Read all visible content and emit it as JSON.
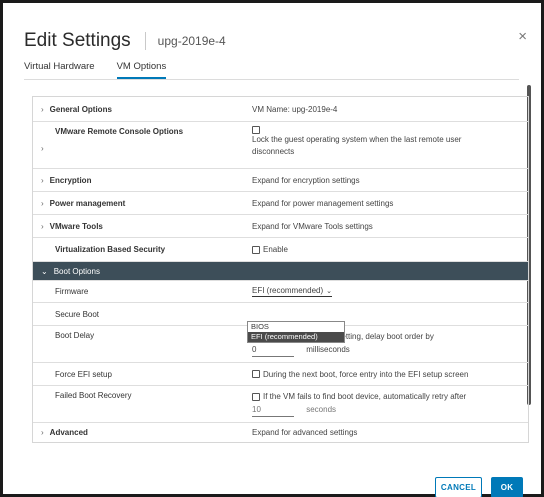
{
  "dialog": {
    "title": "Edit Settings",
    "vm_name": "upg-2019e-4",
    "close_glyph": "×"
  },
  "tabs": [
    {
      "label": "Virtual Hardware",
      "active": false
    },
    {
      "label": "VM Options",
      "active": true
    }
  ],
  "rows": {
    "general": {
      "label": "General Options",
      "value": "VM Name: upg-2019e-4"
    },
    "vmrc": {
      "label": "VMware Remote Console Options",
      "value_line1": "Lock the guest operating system when the last remote user",
      "value_line2": "disconnects"
    },
    "encryption": {
      "label": "Encryption",
      "value": "Expand for encryption settings"
    },
    "power": {
      "label": "Power management",
      "value": "Expand for power management settings"
    },
    "tools": {
      "label": "VMware Tools",
      "value": "Expand for VMware Tools settings"
    },
    "vbs": {
      "label": "Virtualization Based Security",
      "value": "Enable"
    },
    "boot": {
      "label": "Boot Options"
    },
    "firmware": {
      "label": "Firmware",
      "value": "EFI (recommended)"
    },
    "secure_boot": {
      "label": "Secure Boot"
    },
    "boot_delay": {
      "label": "Boot Delay",
      "value_line1": "When powering on or resetting, delay boot order by",
      "value": "0",
      "unit": "milliseconds"
    },
    "force_efi": {
      "label": "Force EFI setup",
      "value": "During the next boot, force entry into the EFI setup screen"
    },
    "failed_boot": {
      "label": "Failed Boot Recovery",
      "value_line1": "If the VM fails to find boot device, automatically retry after",
      "value": "10",
      "unit": "seconds"
    },
    "advanced": {
      "label": "Advanced",
      "value": "Expand for advanced settings"
    }
  },
  "firmware_dropdown": {
    "options": [
      "BIOS",
      "EFI (recommended)"
    ],
    "selected": "EFI (recommended)"
  },
  "footer": {
    "cancel_label": "CANCEL",
    "ok_label": "OK"
  },
  "colors": {
    "accent": "#0079b8",
    "section_header": "#3d4e59"
  }
}
